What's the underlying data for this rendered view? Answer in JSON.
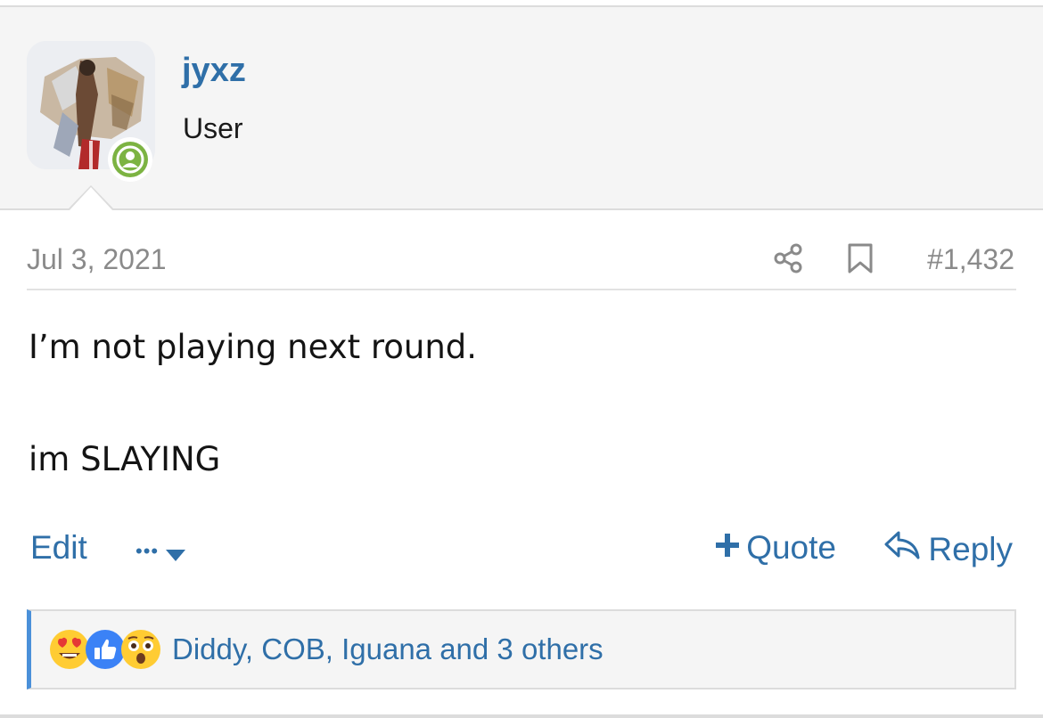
{
  "user": {
    "name": "jyxz",
    "title": "User"
  },
  "post": {
    "date": "Jul 3, 2021",
    "number": "#1,432",
    "body": [
      "I’m not playing next round.",
      "im SLAYING"
    ]
  },
  "actions": {
    "edit_label": "Edit",
    "more_label": "•••",
    "quote_label": "Quote",
    "reply_label": "Reply"
  },
  "reactions": {
    "emojis": [
      "heart-eyes",
      "like",
      "astonished"
    ],
    "summary": "Diddy, COB, Iguana and 3 others"
  },
  "icons": {
    "share": "share-icon",
    "bookmark": "bookmark-icon",
    "online": "user-online-icon",
    "quote_plus": "plus-icon",
    "reply_arrow": "reply-arrow-icon",
    "dropdown": "chevron-down-icon"
  },
  "colors": {
    "link": "#2f6fa8",
    "online": "#7cb342",
    "reaction_accent": "#4a90d9",
    "muted": "#8a8a8a"
  }
}
